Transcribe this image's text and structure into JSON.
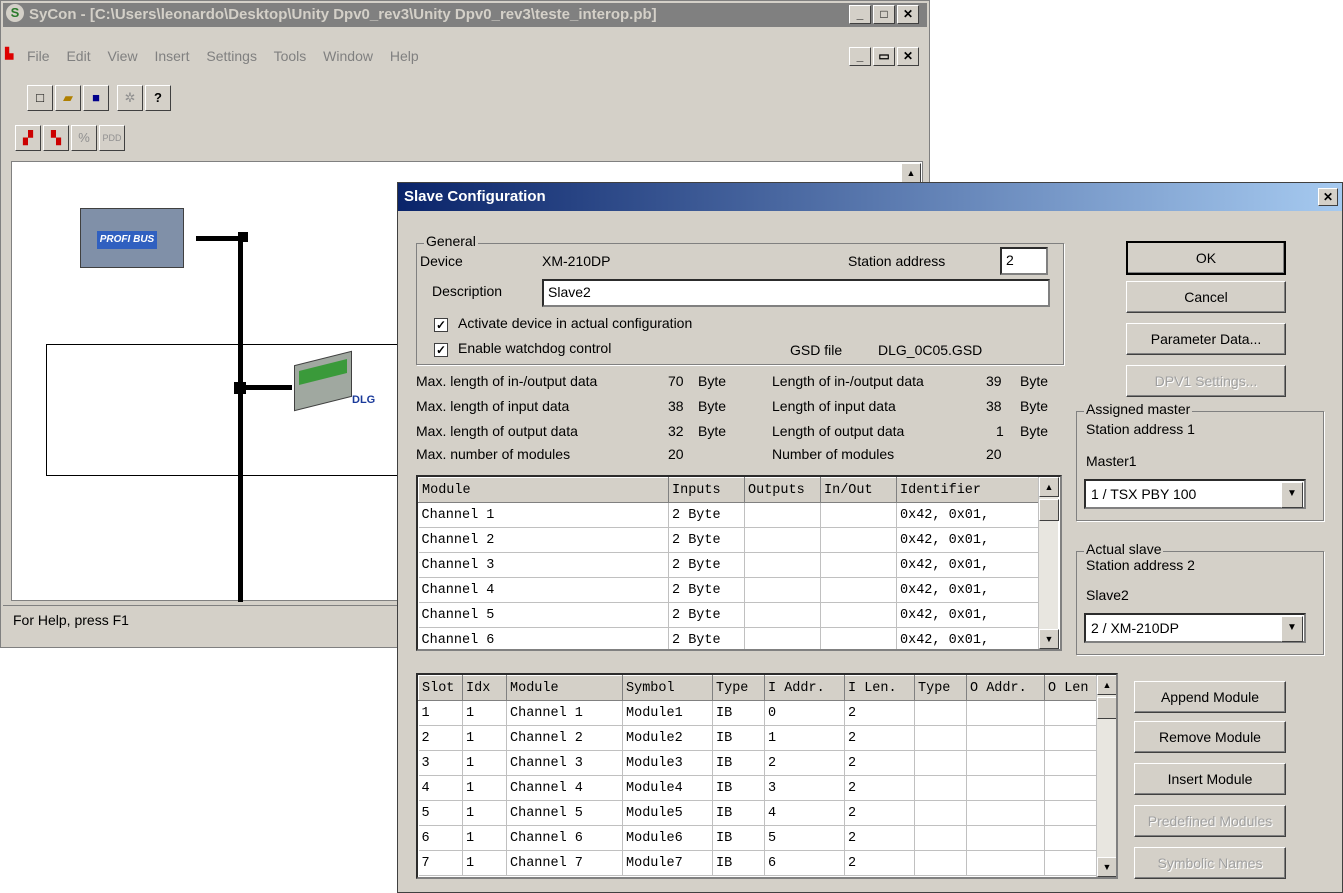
{
  "main_window": {
    "title": "SyCon - [C:\\Users\\leonardo\\Desktop\\Unity Dpv0_rev3\\Unity Dpv0_rev3\\teste_interop.pb]",
    "menu": [
      "File",
      "Edit",
      "View",
      "Insert",
      "Settings",
      "Tools",
      "Window",
      "Help"
    ],
    "toolbar_pdd": "PDD",
    "status": "For Help, press F1",
    "master_logo_text": "PROFI BUS",
    "slave_logo_text": "DLG"
  },
  "dialog": {
    "title": "Slave Configuration",
    "general": {
      "group_label": "General",
      "device_label": "Device",
      "device_value": "XM-210DP",
      "station_address_label": "Station address",
      "station_address_value": "2",
      "description_label": "Description",
      "description_value": "Slave2",
      "activate_label": "Activate device in actual configuration",
      "activate_checked": true,
      "watchdog_label": "Enable watchdog control",
      "watchdog_checked": true,
      "gsd_label": "GSD file",
      "gsd_value": "DLG_0C05.GSD"
    },
    "lengths": {
      "max_io_label": "Max. length of in-/output data",
      "max_io_value": "70",
      "max_io_unit": "Byte",
      "max_in_label": "Max. length of input data",
      "max_in_value": "38",
      "max_in_unit": "Byte",
      "max_out_label": "Max. length of output data",
      "max_out_value": "32",
      "max_out_unit": "Byte",
      "max_mod_label": "Max. number of modules",
      "max_mod_value": "20",
      "io_label": "Length of in-/output data",
      "io_value": "39",
      "io_unit": "Byte",
      "in_label": "Length of input data",
      "in_value": "38",
      "in_unit": "Byte",
      "out_label": "Length of output data",
      "out_value": "1",
      "out_unit": "Byte",
      "mod_label": "Number of modules",
      "mod_value": "20"
    },
    "module_table": {
      "headers": [
        "Module",
        "Inputs",
        "Outputs",
        "In/Out",
        "Identifier"
      ],
      "rows": [
        [
          "Channel 1",
          "2 Byte",
          "",
          "",
          "0x42, 0x01,"
        ],
        [
          "Channel 2",
          "2 Byte",
          "",
          "",
          "0x42, 0x01,"
        ],
        [
          "Channel 3",
          "2 Byte",
          "",
          "",
          "0x42, 0x01,"
        ],
        [
          "Channel 4",
          "2 Byte",
          "",
          "",
          "0x42, 0x01,"
        ],
        [
          "Channel 5",
          "2 Byte",
          "",
          "",
          "0x42, 0x01,"
        ],
        [
          "Channel 6",
          "2 Byte",
          "",
          "",
          "0x42, 0x01,"
        ]
      ]
    },
    "slot_table": {
      "headers": [
        "Slot",
        "Idx",
        "Module",
        "Symbol",
        "Type",
        "I Addr.",
        "I Len.",
        "Type",
        "O Addr.",
        "O Len"
      ],
      "rows": [
        [
          "1",
          "1",
          "Channel 1",
          "Module1",
          "IB",
          "0",
          "2",
          "",
          "",
          ""
        ],
        [
          "2",
          "1",
          "Channel 2",
          "Module2",
          "IB",
          "1",
          "2",
          "",
          "",
          ""
        ],
        [
          "3",
          "1",
          "Channel 3",
          "Module3",
          "IB",
          "2",
          "2",
          "",
          "",
          ""
        ],
        [
          "4",
          "1",
          "Channel 4",
          "Module4",
          "IB",
          "3",
          "2",
          "",
          "",
          ""
        ],
        [
          "5",
          "1",
          "Channel 5",
          "Module5",
          "IB",
          "4",
          "2",
          "",
          "",
          ""
        ],
        [
          "6",
          "1",
          "Channel 6",
          "Module6",
          "IB",
          "5",
          "2",
          "",
          "",
          ""
        ],
        [
          "7",
          "1",
          "Channel 7",
          "Module7",
          "IB",
          "6",
          "2",
          "",
          "",
          ""
        ]
      ]
    },
    "buttons": {
      "ok": "OK",
      "cancel": "Cancel",
      "parameter_data": "Parameter Data...",
      "dpv1": "DPV1 Settings...",
      "append": "Append Module",
      "remove": "Remove Module",
      "insert": "Insert Module",
      "predefined": "Predefined Modules",
      "symbolic": "Symbolic Names"
    },
    "assigned_master": {
      "group_label": "Assigned master",
      "station_text": "Station address 1",
      "name": "Master1",
      "selected": "1 / TSX PBY 100"
    },
    "actual_slave": {
      "group_label": "Actual slave",
      "station_text": "Station address 2",
      "name": "Slave2",
      "selected": "2 / XM-210DP"
    }
  }
}
